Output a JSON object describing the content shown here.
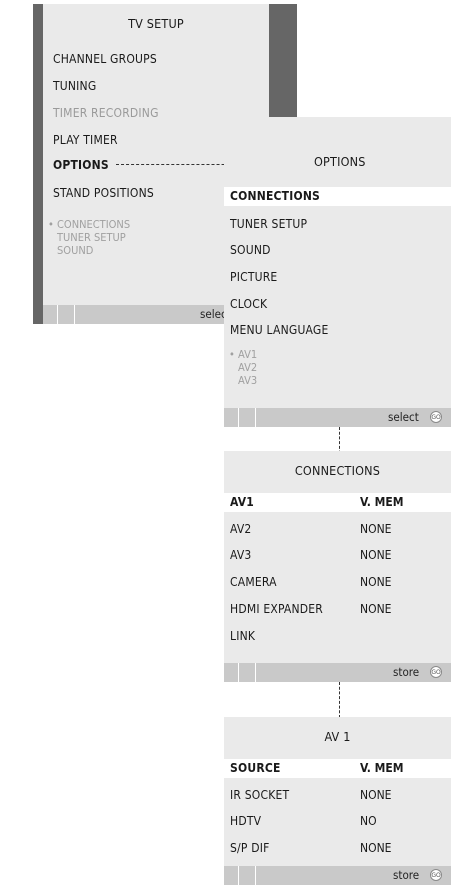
{
  "tv_setup": {
    "title": "TV SETUP",
    "items": [
      {
        "label": "CHANNEL GROUPS",
        "state": "normal"
      },
      {
        "label": "TUNING",
        "state": "normal"
      },
      {
        "label": "TIMER RECORDING",
        "state": "dimmed"
      },
      {
        "label": "PLAY TIMER",
        "state": "normal"
      },
      {
        "label": "OPTIONS",
        "state": "selected"
      },
      {
        "label": "STAND POSITIONS",
        "state": "normal"
      }
    ],
    "submenu_preview": [
      "CONNECTIONS",
      "TUNER SETUP",
      "SOUND"
    ],
    "bullet": "•",
    "footer_label": "select"
  },
  "options": {
    "title": "OPTIONS",
    "items": [
      {
        "label": "CONNECTIONS",
        "state": "highlighted"
      },
      {
        "label": "TUNER SETUP",
        "state": "normal"
      },
      {
        "label": "SOUND",
        "state": "normal"
      },
      {
        "label": "PICTURE",
        "state": "normal"
      },
      {
        "label": "CLOCK",
        "state": "normal"
      },
      {
        "label": "MENU LANGUAGE",
        "state": "normal"
      }
    ],
    "submenu_preview": [
      "AV1",
      "AV2",
      "AV3"
    ],
    "bullet": "•",
    "footer_label": "select",
    "go_label": "GO"
  },
  "connections": {
    "title": "CONNECTIONS",
    "rows": [
      {
        "label": "AV1",
        "value": "V. MEM",
        "state": "highlighted"
      },
      {
        "label": "AV2",
        "value": "NONE",
        "state": "normal"
      },
      {
        "label": "AV3",
        "value": "NONE",
        "state": "normal"
      },
      {
        "label": "CAMERA",
        "value": "NONE",
        "state": "normal"
      },
      {
        "label": "HDMI EXPANDER",
        "value": "NONE",
        "state": "normal"
      },
      {
        "label": "LINK",
        "value": "",
        "state": "normal"
      }
    ],
    "footer_label": "store",
    "go_label": "GO"
  },
  "av1": {
    "title": "AV 1",
    "rows": [
      {
        "label": "SOURCE",
        "value": "V. MEM",
        "state": "highlighted"
      },
      {
        "label": "IR SOCKET",
        "value": "NONE",
        "state": "normal"
      },
      {
        "label": "HDTV",
        "value": "NO",
        "state": "normal"
      },
      {
        "label": "S/P DIF",
        "value": "NONE",
        "state": "normal"
      }
    ],
    "footer_label": "store",
    "go_label": "GO"
  }
}
